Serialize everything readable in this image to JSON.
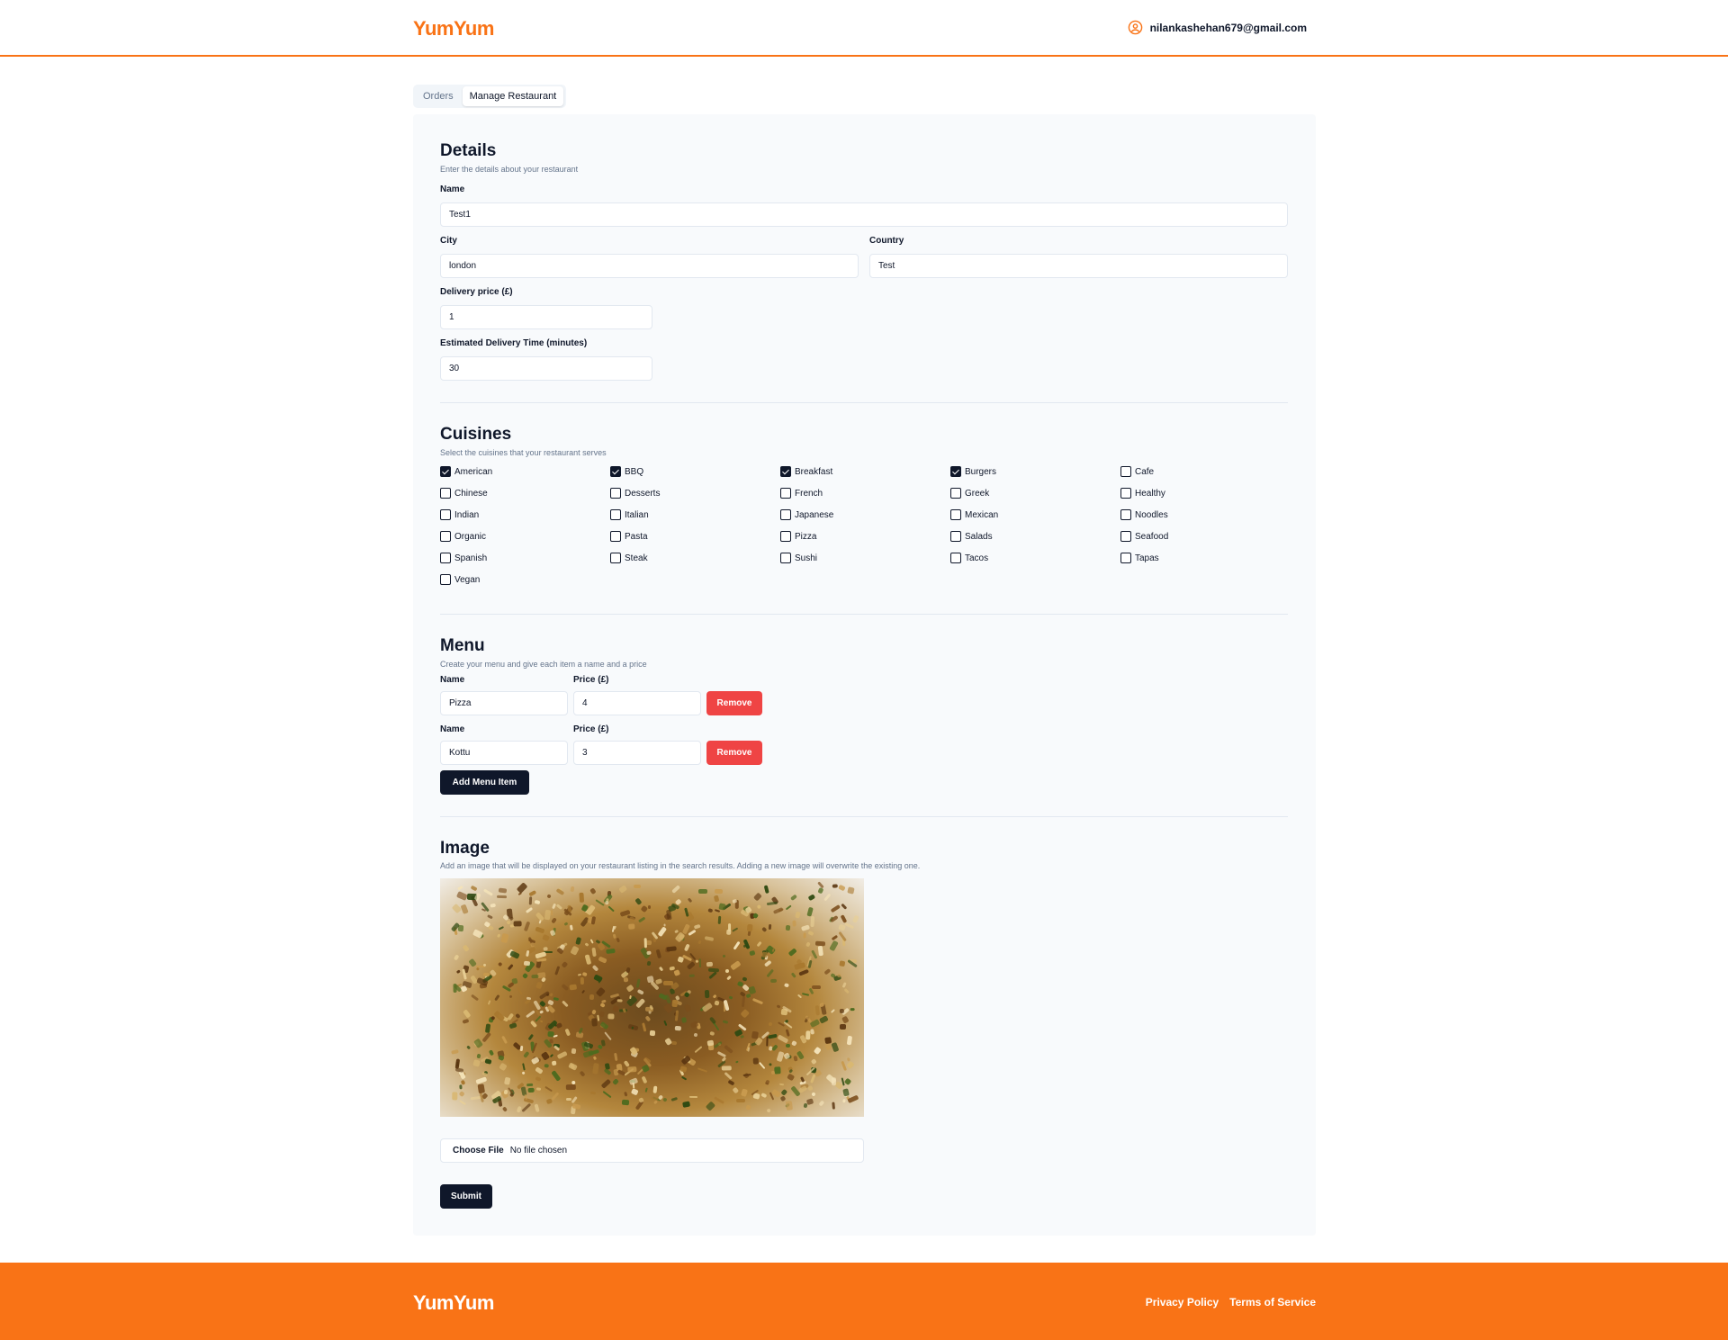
{
  "header": {
    "logo": "YumYum",
    "user_email": "nilankashehan679@gmail.com"
  },
  "tabs": [
    {
      "label": "Orders",
      "active": false
    },
    {
      "label": "Manage Restaurant",
      "active": true
    }
  ],
  "details": {
    "title": "Details",
    "description": "Enter the details about your restaurant",
    "name_label": "Name",
    "name_value": "Test1",
    "city_label": "City",
    "city_value": "london",
    "country_label": "Country",
    "country_value": "Test",
    "delivery_label": "Delivery price (£)",
    "delivery_value": "1",
    "eta_label": "Estimated Delivery Time (minutes)",
    "eta_value": "30"
  },
  "cuisines": {
    "title": "Cuisines",
    "description": "Select the cuisines that your restaurant serves",
    "items": [
      {
        "label": "American",
        "checked": true
      },
      {
        "label": "BBQ",
        "checked": true
      },
      {
        "label": "Breakfast",
        "checked": true
      },
      {
        "label": "Burgers",
        "checked": true
      },
      {
        "label": "Cafe",
        "checked": false
      },
      {
        "label": "Chinese",
        "checked": false
      },
      {
        "label": "Desserts",
        "checked": false
      },
      {
        "label": "French",
        "checked": false
      },
      {
        "label": "Greek",
        "checked": false
      },
      {
        "label": "Healthy",
        "checked": false
      },
      {
        "label": "Indian",
        "checked": false
      },
      {
        "label": "Italian",
        "checked": false
      },
      {
        "label": "Japanese",
        "checked": false
      },
      {
        "label": "Mexican",
        "checked": false
      },
      {
        "label": "Noodles",
        "checked": false
      },
      {
        "label": "Organic",
        "checked": false
      },
      {
        "label": "Pasta",
        "checked": false
      },
      {
        "label": "Pizza",
        "checked": false
      },
      {
        "label": "Salads",
        "checked": false
      },
      {
        "label": "Seafood",
        "checked": false
      },
      {
        "label": "Spanish",
        "checked": false
      },
      {
        "label": "Steak",
        "checked": false
      },
      {
        "label": "Sushi",
        "checked": false
      },
      {
        "label": "Tacos",
        "checked": false
      },
      {
        "label": "Tapas",
        "checked": false
      },
      {
        "label": "Vegan",
        "checked": false
      }
    ]
  },
  "menu": {
    "title": "Menu",
    "description": "Create your menu and give each item a name and a price",
    "name_label": "Name",
    "price_label": "Price (£)",
    "remove_label": "Remove",
    "items": [
      {
        "name": "Pizza",
        "price": "4"
      },
      {
        "name": "Kottu",
        "price": "3"
      }
    ],
    "add_label": "Add Menu Item"
  },
  "image": {
    "title": "Image",
    "description": "Add an image that will be displayed on your restaurant listing in the search results. Adding a new image will overwrite the existing one.",
    "choose_label": "Choose File",
    "no_file": "No file chosen"
  },
  "submit_label": "Submit",
  "footer": {
    "logo": "YumYum",
    "privacy": "Privacy Policy",
    "terms": "Terms of Service"
  },
  "colors": {
    "accent": "#f97316",
    "dark": "#0f172a",
    "danger": "#ef4444"
  }
}
